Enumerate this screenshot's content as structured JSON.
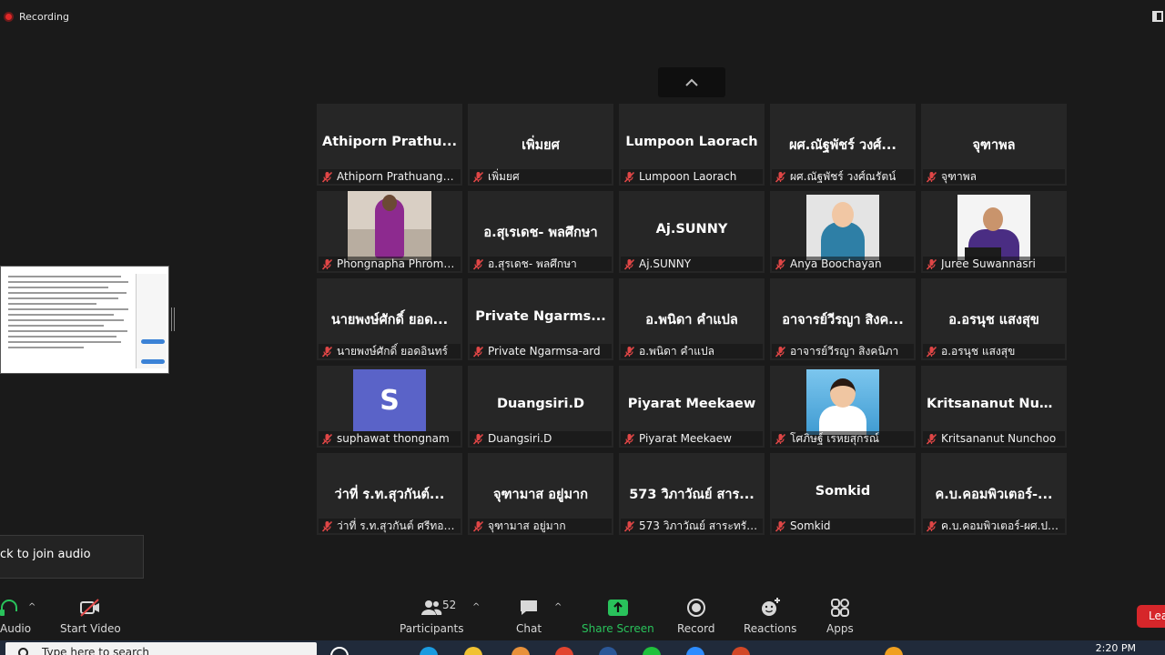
{
  "topbar": {
    "recording_label": "Recording",
    "colors": {
      "recording_dot": "#e02828"
    }
  },
  "participants": [
    {
      "display": "Athiporn  Prathu...",
      "name": "Athiporn Prathuangset",
      "video": false
    },
    {
      "display": "เพิ่มยศ",
      "name": "เพิ่มยศ",
      "video": false
    },
    {
      "display": "Lumpoon Laorach",
      "name": "Lumpoon Laorach",
      "video": false
    },
    {
      "display": "ผศ.ณัฐพัชร์ วงศ์...",
      "name": "ผศ.ณัฐพัชร์ วงศ์ณรัตน์",
      "video": false
    },
    {
      "display": "จุฑาพล",
      "name": "จุฑาพล",
      "video": false
    },
    {
      "display": "",
      "name": "Phongnapha Phromkat",
      "video": true
    },
    {
      "display": "อ.สุเรเดช- พลศึกษา",
      "name": "อ.สุรเดช- พลศึกษา",
      "video": false
    },
    {
      "display": "Aj.SUNNY",
      "name": "Aj.SUNNY",
      "video": false
    },
    {
      "display": "",
      "name": "Anya Boochayan",
      "video": true
    },
    {
      "display": "",
      "name": "Juree Suwannasri",
      "video": true
    },
    {
      "display": "นายพงษ์ศักดิ์ ยอด...",
      "name": "นายพงษ์ศักดิ์ ยอดอินทร์",
      "video": false
    },
    {
      "display": "Private  Ngarms...",
      "name": "Private Ngarmsa-ard",
      "video": false
    },
    {
      "display": "อ.พนิดา คำแปล",
      "name": "อ.พนิดา คำแปล",
      "video": false
    },
    {
      "display": "อาจารย์วีรญา สิงค...",
      "name": "อาจารย์วีรญา สิงคนิภา",
      "video": false
    },
    {
      "display": "อ.อรนุช แสงสุข",
      "name": "อ.อรนุช แสงสุข",
      "video": false
    },
    {
      "display": "",
      "name": "suphawat thongnam",
      "video": false,
      "avatar": "S"
    },
    {
      "display": "Duangsiri.D",
      "name": "Duangsiri.D",
      "video": false
    },
    {
      "display": "Piyarat Meekaew",
      "name": "Piyarat Meekaew",
      "video": false
    },
    {
      "display": "",
      "name": "โศภิษฐ์ เรหยสุกรณ์",
      "video": true
    },
    {
      "display": "Kritsananut  Nun...",
      "name": "Kritsananut Nunchoo",
      "video": false
    },
    {
      "display": "ว่าที่ ร.ท.สุวกันต์...",
      "name": "ว่าที่ ร.ท.สุวกันต์ ศรีทองสั้...",
      "video": false
    },
    {
      "display": "จุฑามาส อยู่มาก",
      "name": "จุฑามาส อยู่มาก",
      "video": false
    },
    {
      "display": "573 วิภาวัณย์ สาร...",
      "name": "573 วิภาวัณย์ สาระทรัพย์",
      "video": false
    },
    {
      "display": "Somkid",
      "name": "Somkid",
      "video": false
    },
    {
      "display": "ค.บ.คอมพิวเตอร์-...",
      "name": "ค.บ.คอมพิวเตอร์-ผศ.ปรีย...",
      "video": false
    }
  ],
  "toast": {
    "text": "ck to join audio"
  },
  "toolbar": {
    "audio_label": "Audio",
    "start_video_label": "Start Video",
    "participants_label": "Participants",
    "participants_count": "52",
    "chat_label": "Chat",
    "share_screen_label": "Share Screen",
    "record_label": "Record",
    "reactions_label": "Reactions",
    "apps_label": "Apps",
    "leave_label": "Leave",
    "colors": {
      "share_green": "#29c25b",
      "leave_red": "#d6262a"
    }
  },
  "taskbar": {
    "search_placeholder": "Type here to search",
    "clock": "2:20 PM"
  }
}
